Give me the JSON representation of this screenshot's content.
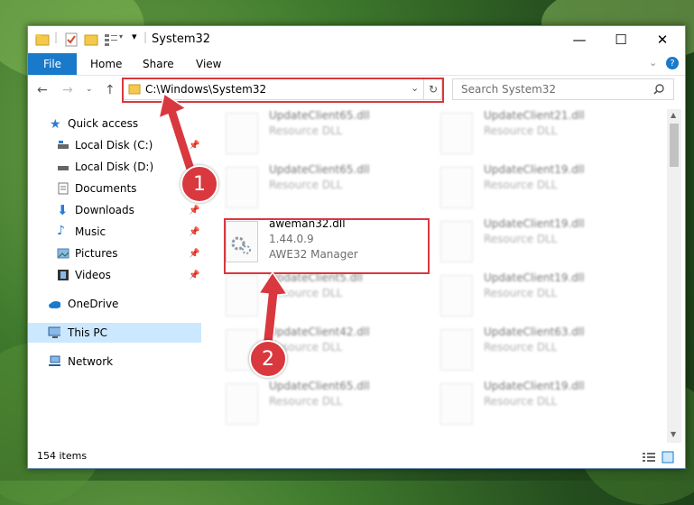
{
  "window": {
    "title": "System32",
    "minimize": "—",
    "maximize": "☐",
    "close": "✕"
  },
  "ribbon": {
    "tabs": [
      "File",
      "Home",
      "Share",
      "View"
    ]
  },
  "nav": {
    "address": "C:\\Windows\\System32",
    "search_placeholder": "Search System32"
  },
  "sidebar": {
    "items": [
      {
        "label": "Quick access",
        "pinned": false
      },
      {
        "label": "Local Disk (C:)",
        "pinned": true
      },
      {
        "label": "Local Disk (D:)",
        "pinned": false
      },
      {
        "label": "Documents",
        "pinned": true
      },
      {
        "label": "Downloads",
        "pinned": true
      },
      {
        "label": "Music",
        "pinned": true
      },
      {
        "label": "Pictures",
        "pinned": true
      },
      {
        "label": "Videos",
        "pinned": true
      },
      {
        "label": "OneDrive",
        "pinned": false
      },
      {
        "label": "This PC",
        "pinned": false
      },
      {
        "label": "Network",
        "pinned": false
      }
    ]
  },
  "files": {
    "left": [
      {
        "name": "UpdateClient65.dll",
        "desc": "Resource DLL"
      },
      {
        "name": "UpdateClient65.dll",
        "desc": "Resource DLL"
      },
      {
        "name": "aweman32.dll",
        "version": "1.44.0.9",
        "desc": "AWE32 Manager"
      },
      {
        "name": "UpdateClient5.dll",
        "desc": "Resource DLL"
      },
      {
        "name": "UpdateClient42.dll",
        "desc": "Resource DLL"
      },
      {
        "name": "UpdateClient65.dll",
        "desc": "Resource DLL"
      }
    ],
    "right": [
      {
        "name": "UpdateClient21.dll",
        "desc": "Resource DLL"
      },
      {
        "name": "UpdateClient19.dll",
        "desc": "Resource DLL"
      },
      {
        "name": "UpdateClient19.dll",
        "desc": "Resource DLL"
      },
      {
        "name": "UpdateClient19.dll",
        "desc": "Resource DLL"
      },
      {
        "name": "UpdateClient63.dll",
        "desc": "Resource DLL"
      },
      {
        "name": "UpdateClient19.dll",
        "desc": "Resource DLL"
      }
    ]
  },
  "status": {
    "count": "154 items"
  },
  "annotations": {
    "step1": "1",
    "step2": "2",
    "color": "#d9383e"
  }
}
